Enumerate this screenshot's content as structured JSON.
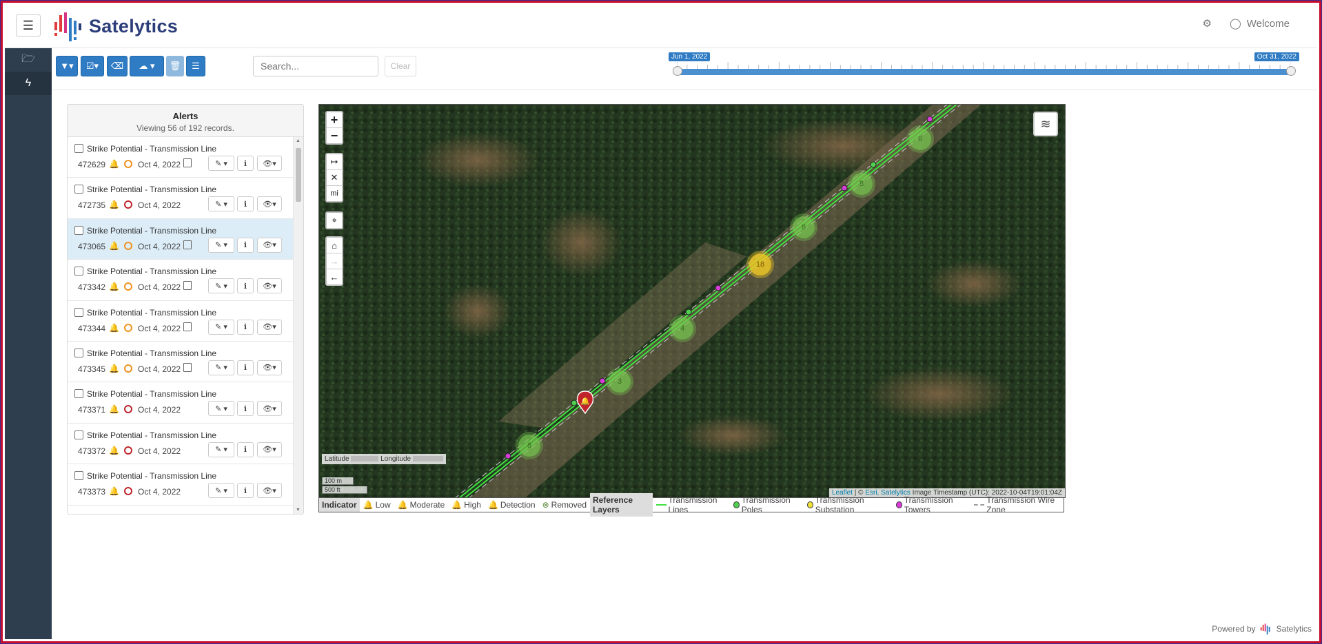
{
  "app": {
    "brand": "Satelytics",
    "welcome": "Welcome"
  },
  "toolbar": {
    "search_placeholder": "Search...",
    "clear_label": "Clear"
  },
  "timeline": {
    "start": "Jun 1, 2022",
    "end": "Oct 31, 2022"
  },
  "alerts": {
    "title": "Alerts",
    "subtitle": "Viewing 56 of 192 records.",
    "rows": [
      {
        "title": "Strike Potential - Transmission Line",
        "id": "472629",
        "level": "high",
        "date": "Oct 4, 2022",
        "image": true
      },
      {
        "title": "Strike Potential - Transmission Line",
        "id": "472735",
        "level": "moderate",
        "date": "Oct 4, 2022",
        "image": false
      },
      {
        "title": "Strike Potential - Transmission Line",
        "id": "473065",
        "level": "high",
        "date": "Oct 4, 2022",
        "image": true
      },
      {
        "title": "Strike Potential - Transmission Line",
        "id": "473342",
        "level": "high",
        "date": "Oct 4, 2022",
        "image": true
      },
      {
        "title": "Strike Potential - Transmission Line",
        "id": "473344",
        "level": "high",
        "date": "Oct 4, 2022",
        "image": true
      },
      {
        "title": "Strike Potential - Transmission Line",
        "id": "473345",
        "level": "high",
        "date": "Oct 4, 2022",
        "image": true
      },
      {
        "title": "Strike Potential - Transmission Line",
        "id": "473371",
        "level": "low",
        "date": "Oct 4, 2022",
        "image": false
      },
      {
        "title": "Strike Potential - Transmission Line",
        "id": "473372",
        "level": "low",
        "date": "Oct 4, 2022",
        "image": false
      },
      {
        "title": "Strike Potential - Transmission Line",
        "id": "473373",
        "level": "low",
        "date": "Oct 4, 2022",
        "image": false
      }
    ]
  },
  "map": {
    "units_label": "mi",
    "latitude_label": "Latitude",
    "longitude_label": "Longitude",
    "scale_m": "100 m",
    "scale_ft": "500 ft",
    "attrib_leaflet": "Leaflet",
    "attrib_sep": " | © ",
    "attrib_esri": "Esri, Satelytics",
    "attrib_ts": " Image Timestamp (UTC): 2022-10-04T19:01:04Z",
    "clusters": [
      "6",
      "8",
      "8",
      "18",
      "4",
      "3",
      "8"
    ]
  },
  "legend": {
    "indicator": "Indicator",
    "low": "Low",
    "moderate": "Moderate",
    "high": "High",
    "detection": "Detection",
    "removed": "Removed",
    "ref": "Reference Layers",
    "lines": "Transmission Lines",
    "poles": "Transmission Poles",
    "substation": "Transmission Substation",
    "towers": "Transmission Towers",
    "wire": "Transmission Wire Zone"
  },
  "footer": {
    "powered": "Powered by",
    "brand": "Satelytics"
  },
  "colors": {
    "high": "#c0232c",
    "moderate": "#f0921e",
    "low": "#2f87c8",
    "primary": "#2f7bc4"
  }
}
